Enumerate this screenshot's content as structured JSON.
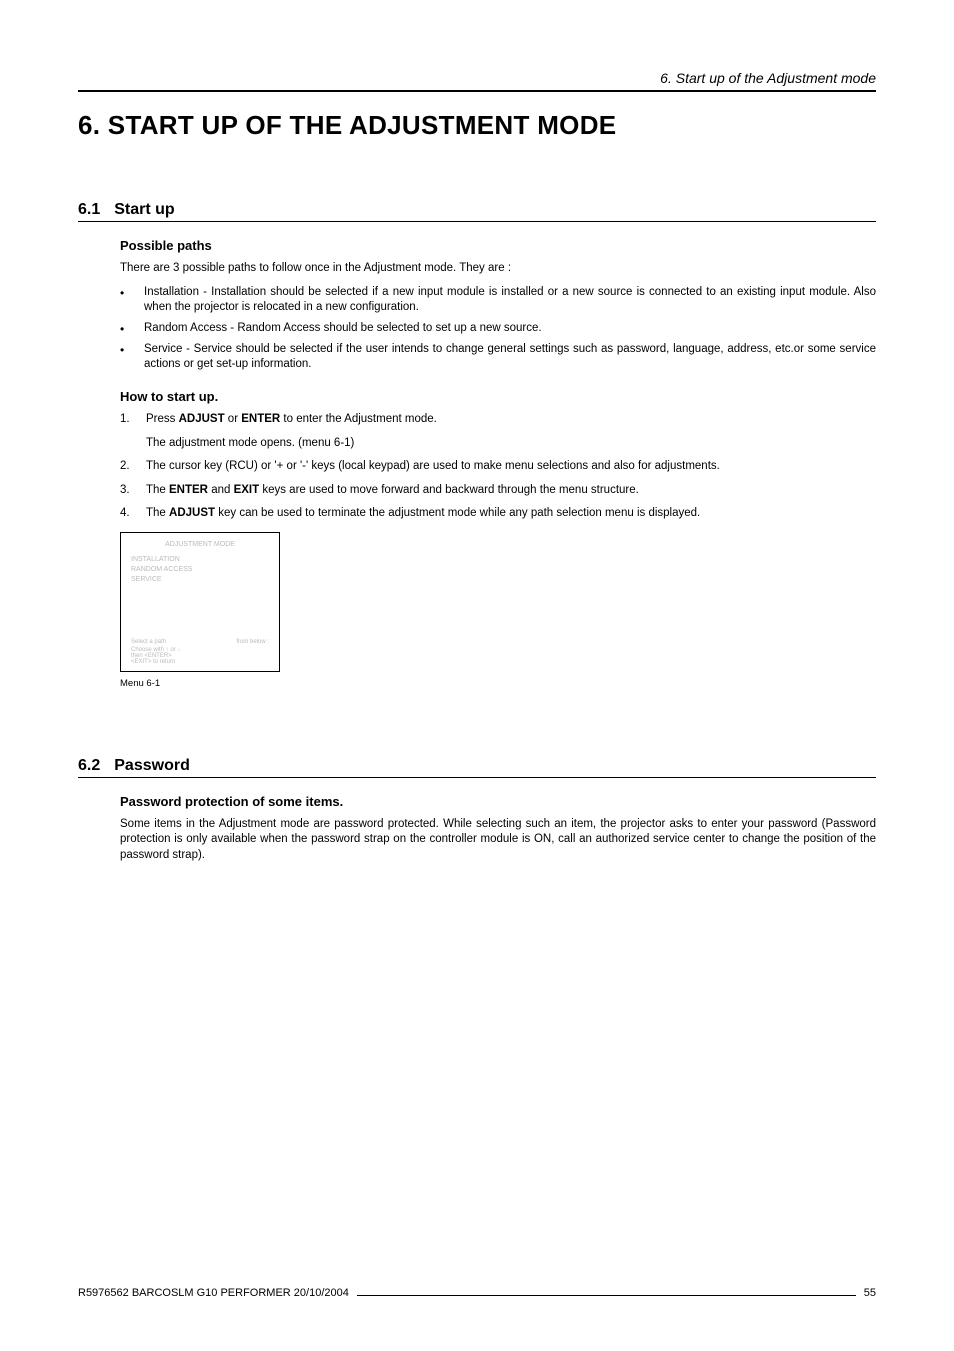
{
  "running_head": "6. Start up of the Adjustment mode",
  "chapter_title": "6. START UP OF THE ADJUSTMENT MODE",
  "sections": {
    "s61": {
      "num": "6.1",
      "label": "Start up",
      "sub1_head": "Possible paths",
      "sub1_intro": "There are 3 possible paths to follow once in the Adjustment mode.  They are :",
      "bullets": {
        "b1": "Installation - Installation should be selected if a new input module is installed or a new source is connected to an existing input module.  Also when the projector is relocated in a new configuration.",
        "b2": "Random Access - Random Access should be selected to set up a new source.",
        "b3": "Service - Service should be selected if the user intends to change general settings such as password, language, address, etc.or some service actions or get set-up information."
      },
      "sub2_head": "How to start up.",
      "steps": {
        "s1_pre": "Press ",
        "s1_b1": "ADJUST",
        "s1_mid": " or ",
        "s1_b2": "ENTER",
        "s1_post": " to enter the Adjustment mode.",
        "s1_sub": "The adjustment mode opens.  (menu 6-1)",
        "s2": "The cursor key (RCU) or '+ or '-' keys (local keypad) are used to make menu selections and also for adjustments.",
        "s3_pre": "The ",
        "s3_b1": "ENTER",
        "s3_mid": " and ",
        "s3_b2": "EXIT",
        "s3_post": " keys are used to move forward and backward through the menu structure.",
        "s4_pre": "The ",
        "s4_b1": "ADJUST",
        "s4_post": " key can be used to terminate the adjustment mode while any path selection menu is displayed."
      },
      "menu": {
        "title": "ADJUSTMENT MODE",
        "i1": "INSTALLATION",
        "i2": "RANDOM ACCESS",
        "i3": "SERVICE",
        "hint1_l": "Select a path",
        "hint1_r": "from below :",
        "hint2": "Choose with ↑ or ↓",
        "hint3": "then <ENTER>",
        "hint4": "<EXIT> to return"
      },
      "menu_caption": "Menu 6-1"
    },
    "s62": {
      "num": "6.2",
      "label": "Password",
      "sub1_head": "Password protection of some items.",
      "para1": "Some items in the Adjustment mode are password protected.  While selecting such an item, the projector asks to enter your password (Password protection is only available when the password strap on the controller module is ON, call an authorized service center to change the position of the password strap)."
    }
  },
  "footer": {
    "left": "R5976562  BARCOSLM G10 PERFORMER  20/10/2004",
    "right": "55"
  }
}
